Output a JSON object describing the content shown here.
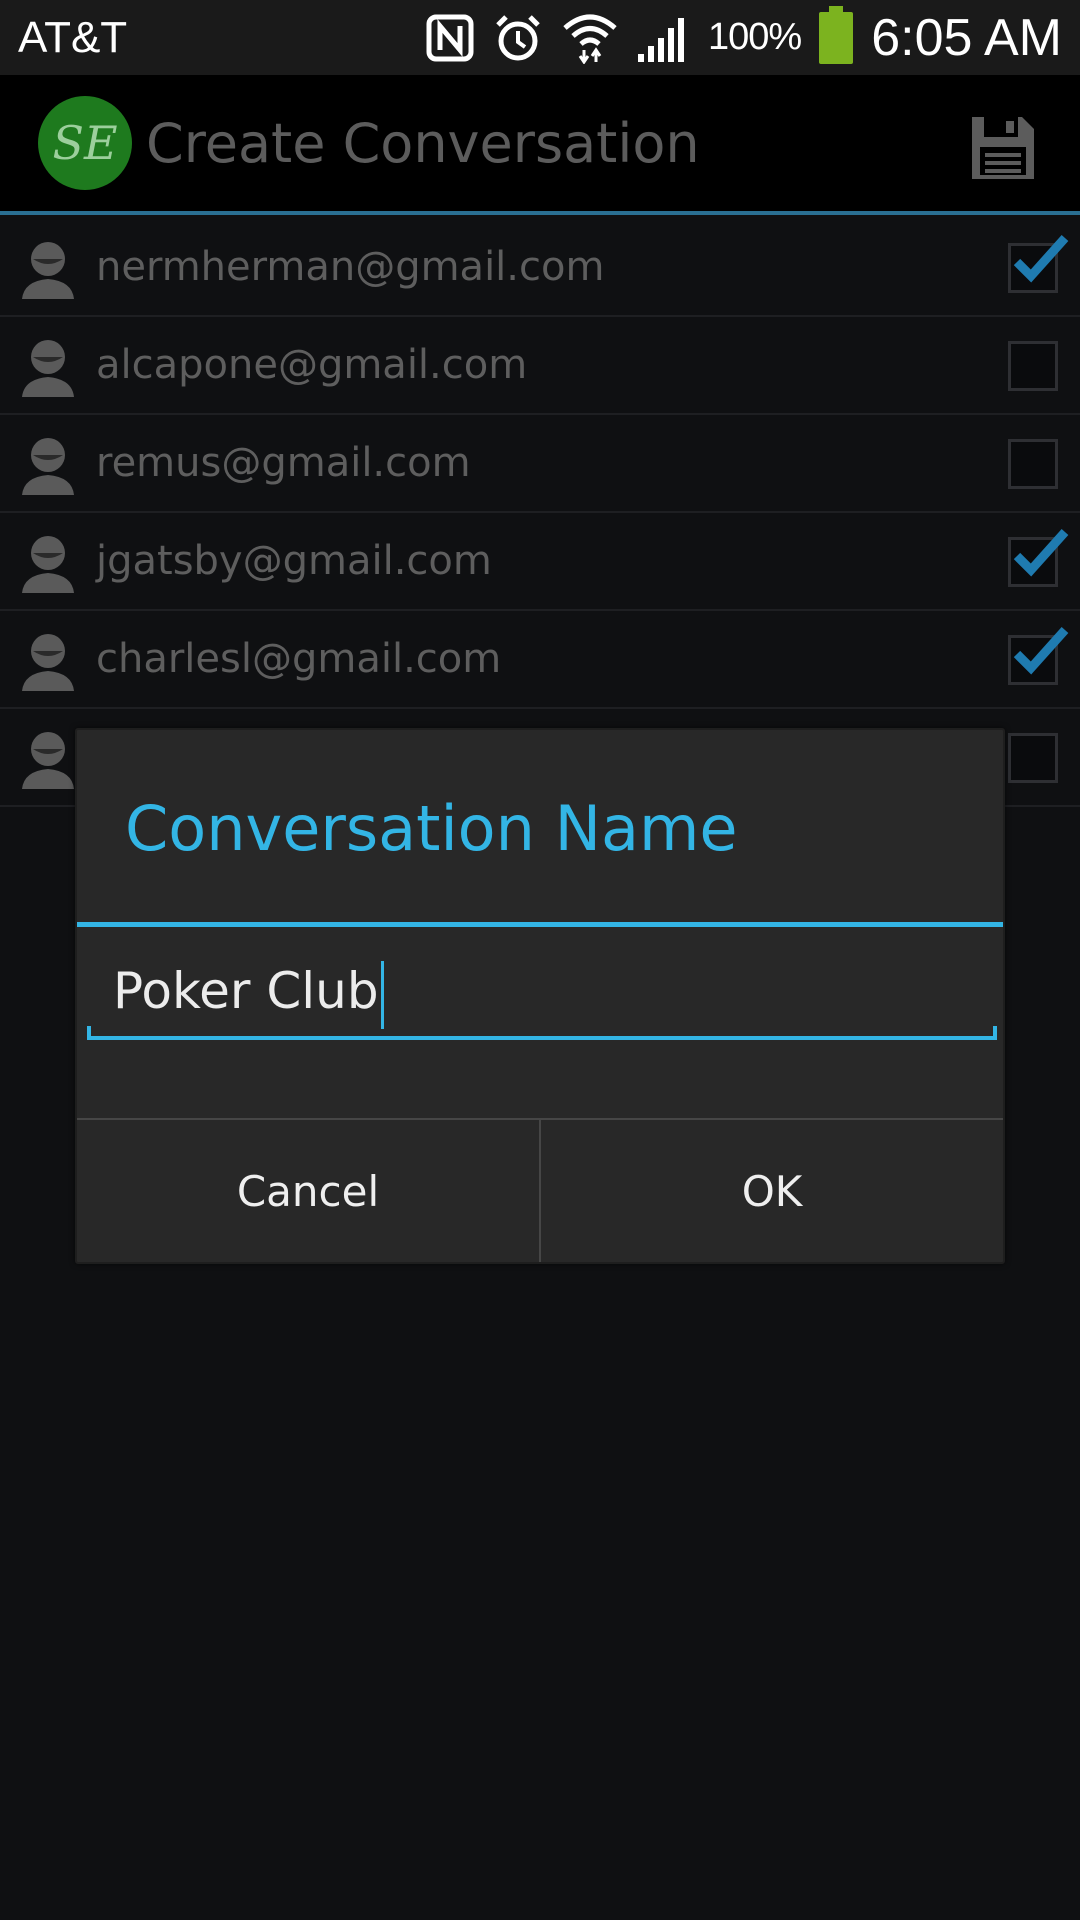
{
  "status_bar": {
    "carrier": "AT&T",
    "battery_percent": "100%",
    "time": "6:05 AM",
    "icons": [
      "nfc-icon",
      "alarm-icon",
      "wifi-icon",
      "signal-icon",
      "battery-icon"
    ],
    "battery_color": "#7cb31f"
  },
  "action_bar": {
    "logo_text": "SE",
    "title": "Create Conversation",
    "save_icon": "save-icon"
  },
  "contacts": [
    {
      "email": "nermherman@gmail.com",
      "checked": true
    },
    {
      "email": "alcapone@gmail.com",
      "checked": false
    },
    {
      "email": "remus@gmail.com",
      "checked": false
    },
    {
      "email": "jgatsby@gmail.com",
      "checked": true
    },
    {
      "email": "charlesl@gmail.com",
      "checked": true
    },
    {
      "email": "",
      "checked": false
    }
  ],
  "dialog": {
    "title": "Conversation Name",
    "input_value": "Poker Club",
    "cancel_label": "Cancel",
    "ok_label": "OK"
  },
  "colors": {
    "accent": "#33b5e5",
    "background": "#0f1012",
    "dialog": "#282828"
  }
}
